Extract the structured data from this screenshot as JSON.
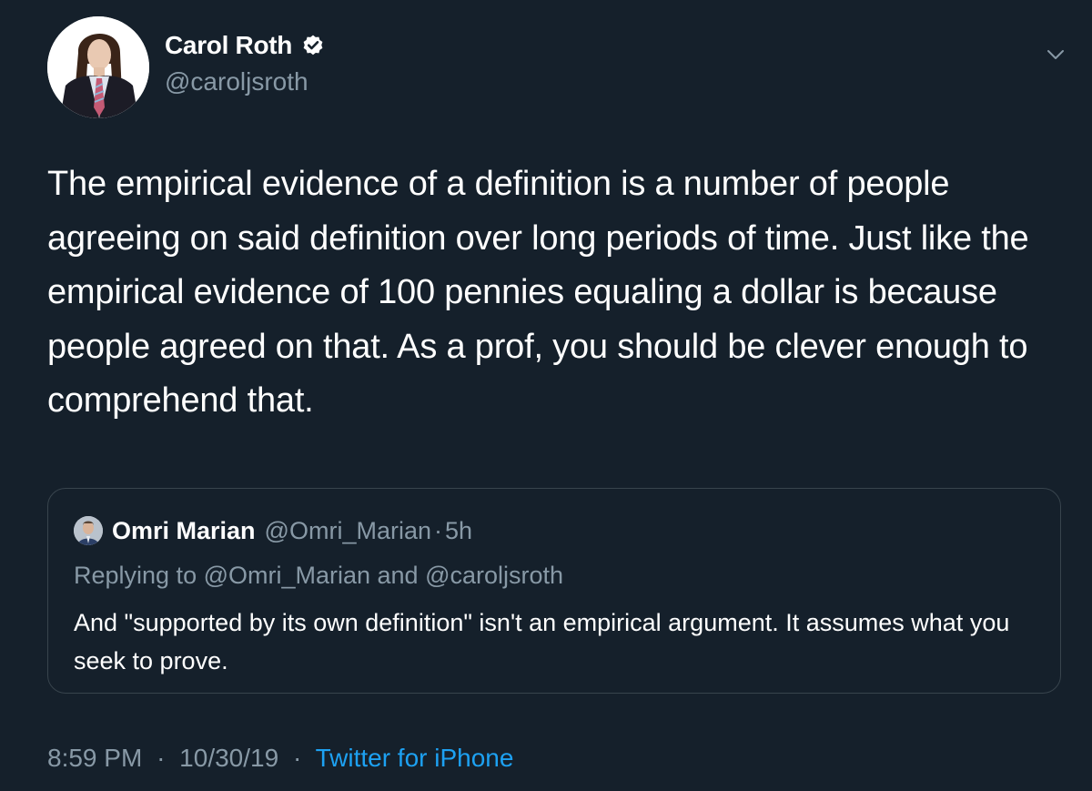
{
  "author": {
    "display_name": "Carol Roth",
    "handle": "@caroljsroth",
    "verified": true
  },
  "tweet": {
    "text": "The empirical evidence of a definition is a number of people agreeing on said definition over long periods of time. Just like the empirical evidence of 100 pennies equaling a dollar is because people agreed on that. As a prof, you should be clever enough to comprehend that."
  },
  "quoted_tweet": {
    "display_name": "Omri Marian",
    "handle": "@Omri_Marian",
    "separator": "·",
    "time": "5h",
    "replying_to": "Replying to @Omri_Marian and @caroljsroth",
    "text": "And \"supported by its own definition\" isn't an empirical argument. It assumes what you seek to prove."
  },
  "meta": {
    "time": "8:59 PM",
    "separator": "·",
    "date": "10/30/19",
    "source": "Twitter for iPhone"
  },
  "icons": {
    "verified": "verified-badge-icon",
    "menu": "chevron-down-icon"
  },
  "colors": {
    "background": "#15202b",
    "text_primary": "#ffffff",
    "text_secondary": "#8899a6",
    "accent": "#1da1f2",
    "border": "#38444d"
  }
}
